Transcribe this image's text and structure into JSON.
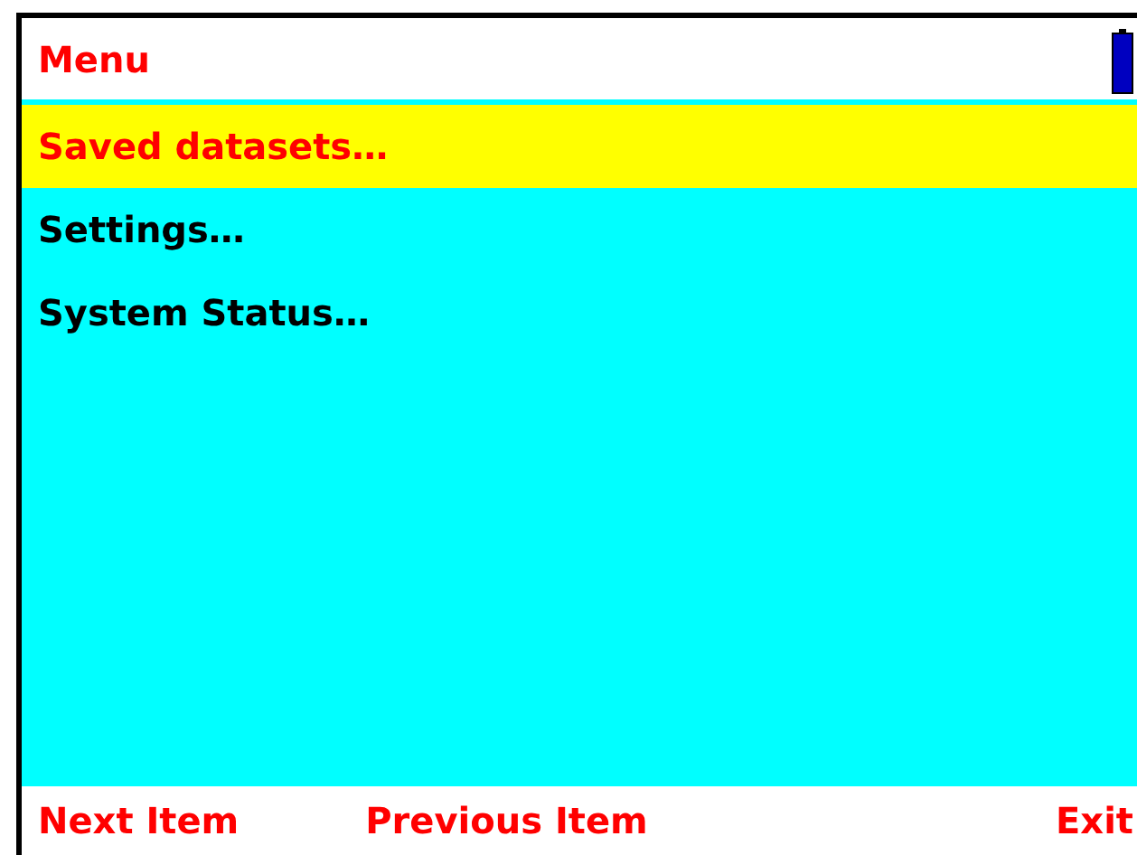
{
  "title": "Menu",
  "items": [
    {
      "label": "Saved datasets…",
      "selected": true
    },
    {
      "label": "Settings…",
      "selected": false
    },
    {
      "label": "System Status…",
      "selected": false
    }
  ],
  "softkeys": [
    "Next Item",
    "Previous Item",
    "Exit"
  ]
}
